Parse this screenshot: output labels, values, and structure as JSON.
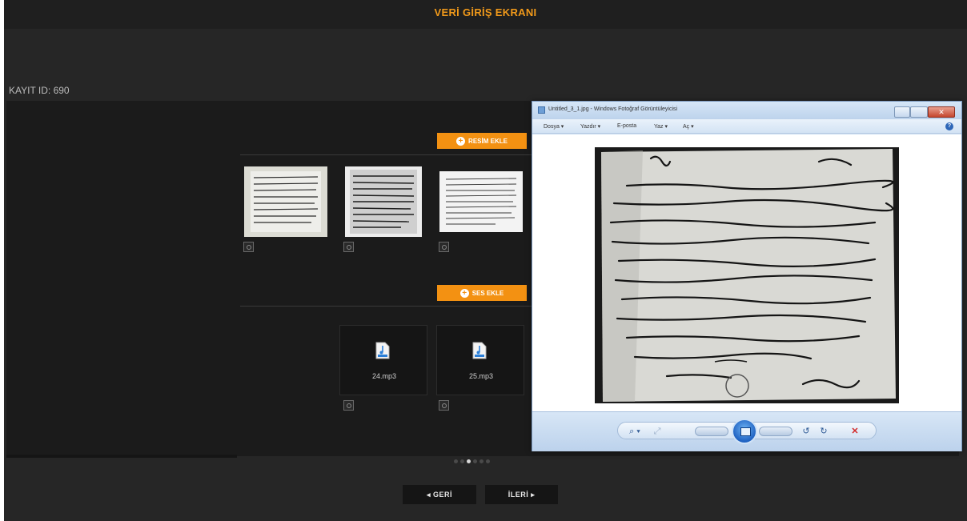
{
  "page": {
    "title": "VERİ GİRİŞ EKRANI",
    "record_id": "KAYIT ID: 690"
  },
  "images_section": {
    "add_button_label": "RESİM EKLE",
    "thumbnails": [
      {
        "name": "manuscript-thumb-1"
      },
      {
        "name": "manuscript-thumb-2"
      },
      {
        "name": "manuscript-thumb-3"
      }
    ]
  },
  "audio_section": {
    "add_button_label": "SES EKLE",
    "files": [
      {
        "name": "24.mp3",
        "icon": "mp3-file-icon"
      },
      {
        "name": "25.mp3",
        "icon": "mp3-file-icon"
      }
    ]
  },
  "pagination": {
    "total": 6,
    "active_index": 3
  },
  "navigation": {
    "back_label": "◂ GERİ",
    "next_label": "İLERİ ▸"
  },
  "photo_viewer": {
    "title": "Untitled_3_1.jpg - Windows Fotoğraf Görüntüleyicisi",
    "menu": {
      "file": "Dosya ▾",
      "print": "Yazdır ▾",
      "email": "E-posta",
      "burn": "Yaz ▾",
      "open": "Aç ▾"
    },
    "controls": {
      "zoom": "⌕ ▾",
      "actual_size": "⤢",
      "previous": "previous",
      "next": "next",
      "rotate_ccw": "↺",
      "rotate_cw": "↻",
      "delete": "✕"
    }
  },
  "colors": {
    "accent": "#f39112",
    "title": "#f29a1a",
    "background": "#262626"
  }
}
